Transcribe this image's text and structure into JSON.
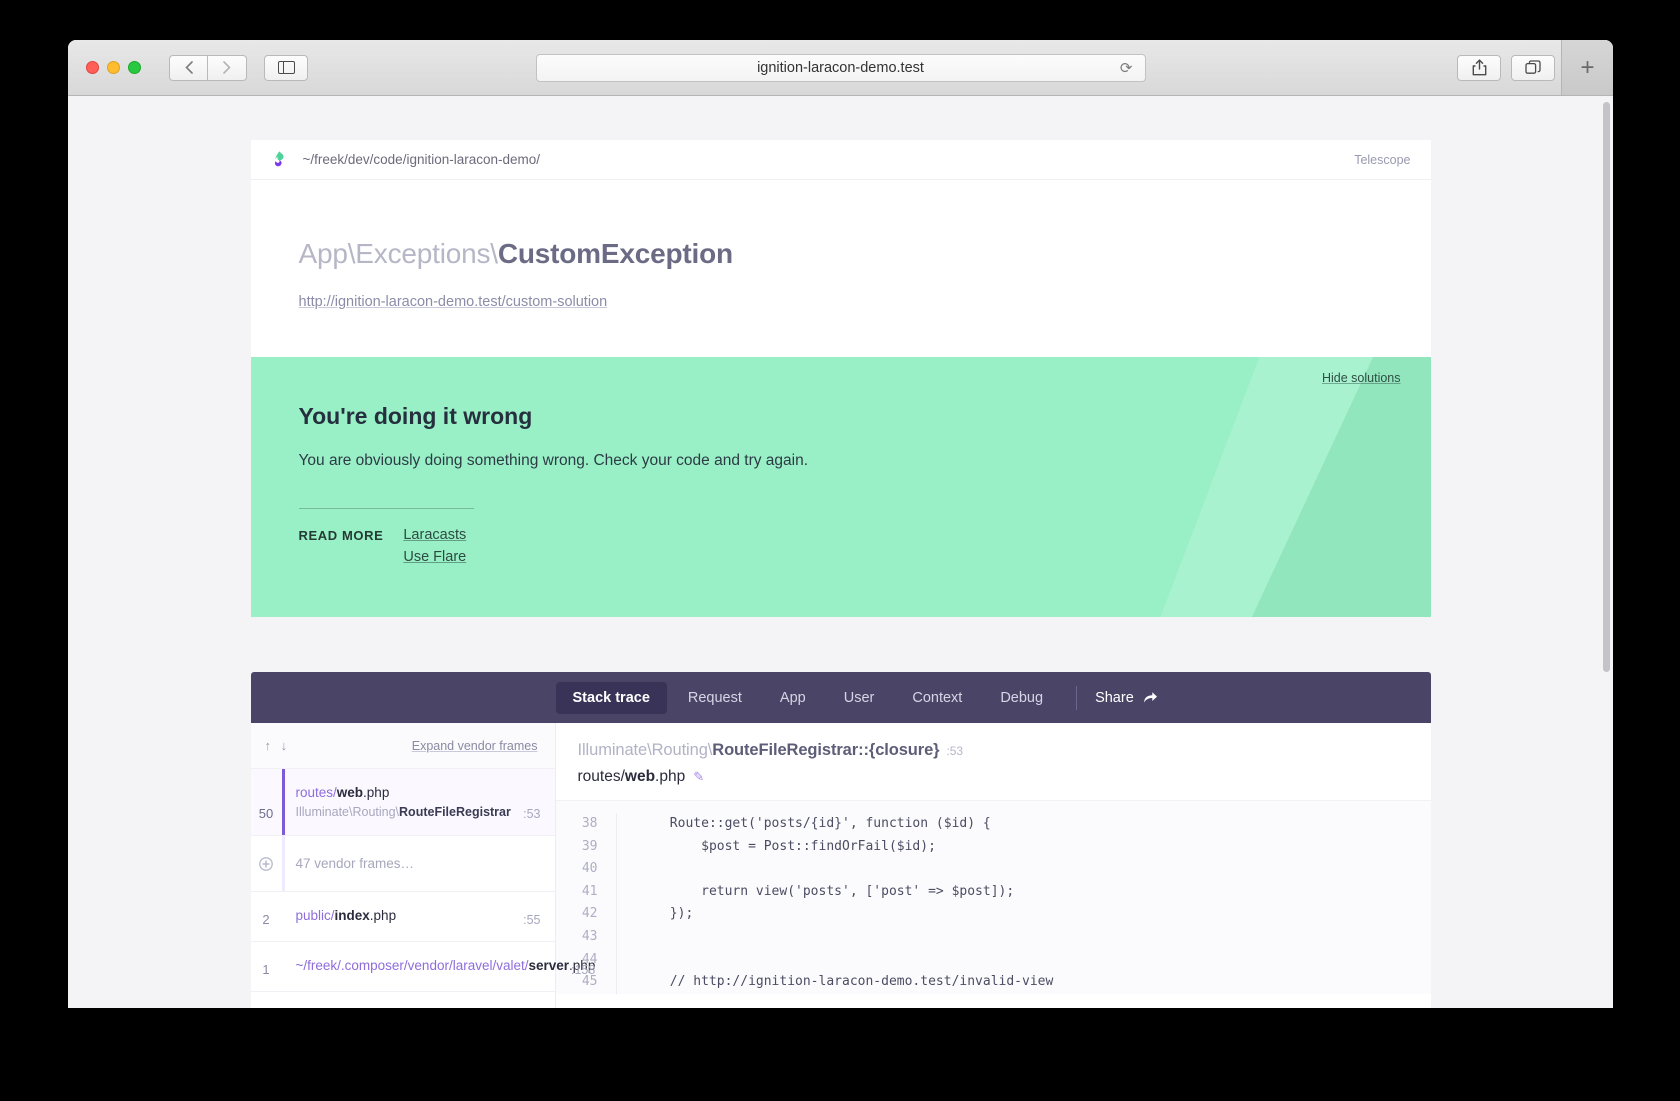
{
  "browser": {
    "url": "ignition-laracon-demo.test",
    "back_icon": "chevron-left-icon",
    "forward_icon": "chevron-right-icon",
    "sidebar_icon": "sidebar-toggle-icon",
    "reload_icon": "reload-icon",
    "share_icon": "share-icon",
    "tabs_icon": "show-tabs-icon",
    "new_tab_label": "+"
  },
  "ignition": {
    "project_path": "~/freek/dev/code/ignition-laracon-demo/",
    "telescope_label": "Telescope",
    "exception_namespace": "App\\Exceptions\\",
    "exception_class": "CustomException",
    "request_url": "http://ignition-laracon-demo.test/custom-solution"
  },
  "solution": {
    "hide_label": "Hide solutions",
    "title": "You're doing it wrong",
    "description": "You are obviously doing something wrong. Check your code and try again.",
    "read_more_label": "READ MORE",
    "links": [
      "Laracasts",
      "Use Flare"
    ]
  },
  "trace": {
    "tabs": [
      {
        "label": "Stack trace",
        "active": true
      },
      {
        "label": "Request",
        "active": false
      },
      {
        "label": "App",
        "active": false
      },
      {
        "label": "User",
        "active": false
      },
      {
        "label": "Context",
        "active": false
      },
      {
        "label": "Debug",
        "active": false
      }
    ],
    "share_label": "Share",
    "share_icon": "share-arrow-icon",
    "sort_arrows": "↑ ↓",
    "expand_vendor_label": "Expand vendor frames",
    "frames": [
      {
        "number": "50",
        "dir": "routes/",
        "file_bold": "web",
        "file_ext": ".php",
        "class_prefix": "Illuminate\\Routing\\",
        "class_bold": "RouteFileRegistrar",
        "line": ":53",
        "selected": true
      },
      {
        "vendor": true,
        "icon": "plus-circle-icon",
        "label": "47 vendor frames…"
      },
      {
        "number": "2",
        "dir": "public/",
        "file_bold": "index",
        "file_ext": ".php",
        "class_prefix": "",
        "class_bold": "",
        "line": ":55",
        "selected": false
      },
      {
        "number": "1",
        "dir": "~/freek/.composer/vendor/laravel/valet/",
        "file_bold": "server",
        "file_ext": ".php",
        "class_prefix": "",
        "class_bold": "",
        "line": ":158",
        "selected": false
      }
    ],
    "code": {
      "signature_prefix": "Illuminate\\Routing\\",
      "signature_bold": "RouteFileRegistrar::{closure}",
      "signature_line": ":53",
      "file_dir": "routes/",
      "file_bold": "web",
      "file_ext": ".php",
      "edit_icon": "pencil-icon",
      "lines": [
        {
          "num": "38",
          "text": "    Route::get('posts/{id}', function ($id) {"
        },
        {
          "num": "39",
          "text": "        $post = Post::findOrFail($id);"
        },
        {
          "num": "40",
          "text": ""
        },
        {
          "num": "41",
          "text": "        return view('posts', ['post' => $post]);"
        },
        {
          "num": "42",
          "text": "    });"
        },
        {
          "num": "43",
          "text": ""
        },
        {
          "num": "44",
          "text": ""
        },
        {
          "num": "45",
          "text": "    // http://ignition-laracon-demo.test/invalid-view"
        }
      ]
    }
  },
  "colors": {
    "solution_green": "#99f0c6",
    "tabbar_purple": "#4a4566",
    "accent_purple": "#7b5cd6"
  }
}
